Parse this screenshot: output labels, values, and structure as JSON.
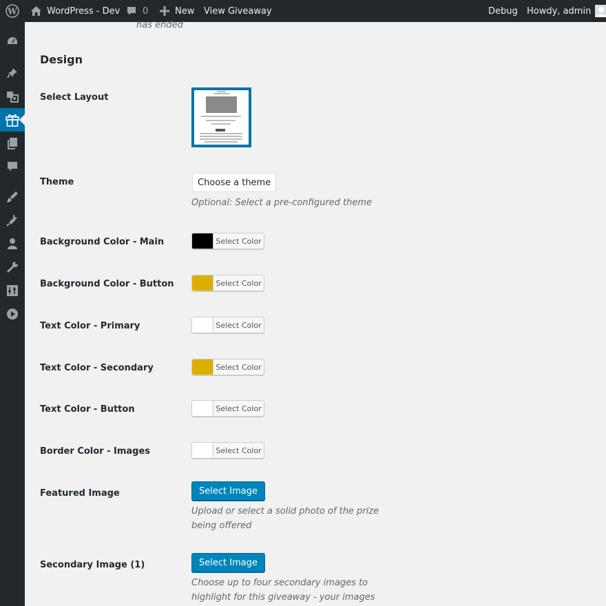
{
  "admin_bar": {
    "site_name": "WordPress - Dev",
    "comments_count": "0",
    "new_label": "New",
    "view_label": "View Giveaway",
    "debug_label": "Debug",
    "howdy_label": "Howdy, admin"
  },
  "sidebar": {
    "items": [
      {
        "icon": "dashboard-icon"
      },
      {
        "icon": "pin-icon"
      },
      {
        "icon": "media-icon"
      },
      {
        "icon": "gift-icon",
        "active": true
      },
      {
        "icon": "pages-icon"
      },
      {
        "icon": "comments-icon"
      },
      {
        "icon": "appearance-icon"
      },
      {
        "icon": "plugins-icon"
      },
      {
        "icon": "users-icon"
      },
      {
        "icon": "tools-icon"
      },
      {
        "icon": "settings-icon"
      },
      {
        "icon": "play-icon"
      }
    ],
    "accent": "#0073aa"
  },
  "main": {
    "top_fragment": "has ended",
    "section_title": "Design",
    "select_layout_label": "Select Layout",
    "theme_label": "Theme",
    "theme_button": "Choose a theme",
    "theme_desc": "Optional: Select a pre-configured theme",
    "colors": [
      {
        "label": "Background Color - Main",
        "value": "#000000",
        "button": "Select Color"
      },
      {
        "label": "Background Color - Button",
        "value": "#dbb000",
        "button": "Select Color"
      },
      {
        "label": "Text Color - Primary",
        "value": "#ffffff",
        "button": "Select Color"
      },
      {
        "label": "Text Color - Secondary",
        "value": "#dbb000",
        "button": "Select Color"
      },
      {
        "label": "Text Color - Button",
        "value": "#ffffff",
        "button": "Select Color"
      },
      {
        "label": "Border Color - Images",
        "value": "#ffffff",
        "button": "Select Color"
      }
    ],
    "featured_label": "Featured Image",
    "featured_button": "Select Image",
    "featured_desc_1": "Upload or select a solid photo of the prize",
    "featured_desc_2": "being offered",
    "secondary_label": "Secondary Image (1)",
    "secondary_button": "Select Image",
    "secondary_desc_1": "Choose up to four secondary images to",
    "secondary_desc_2": "highlight for this giveaway - your images"
  }
}
